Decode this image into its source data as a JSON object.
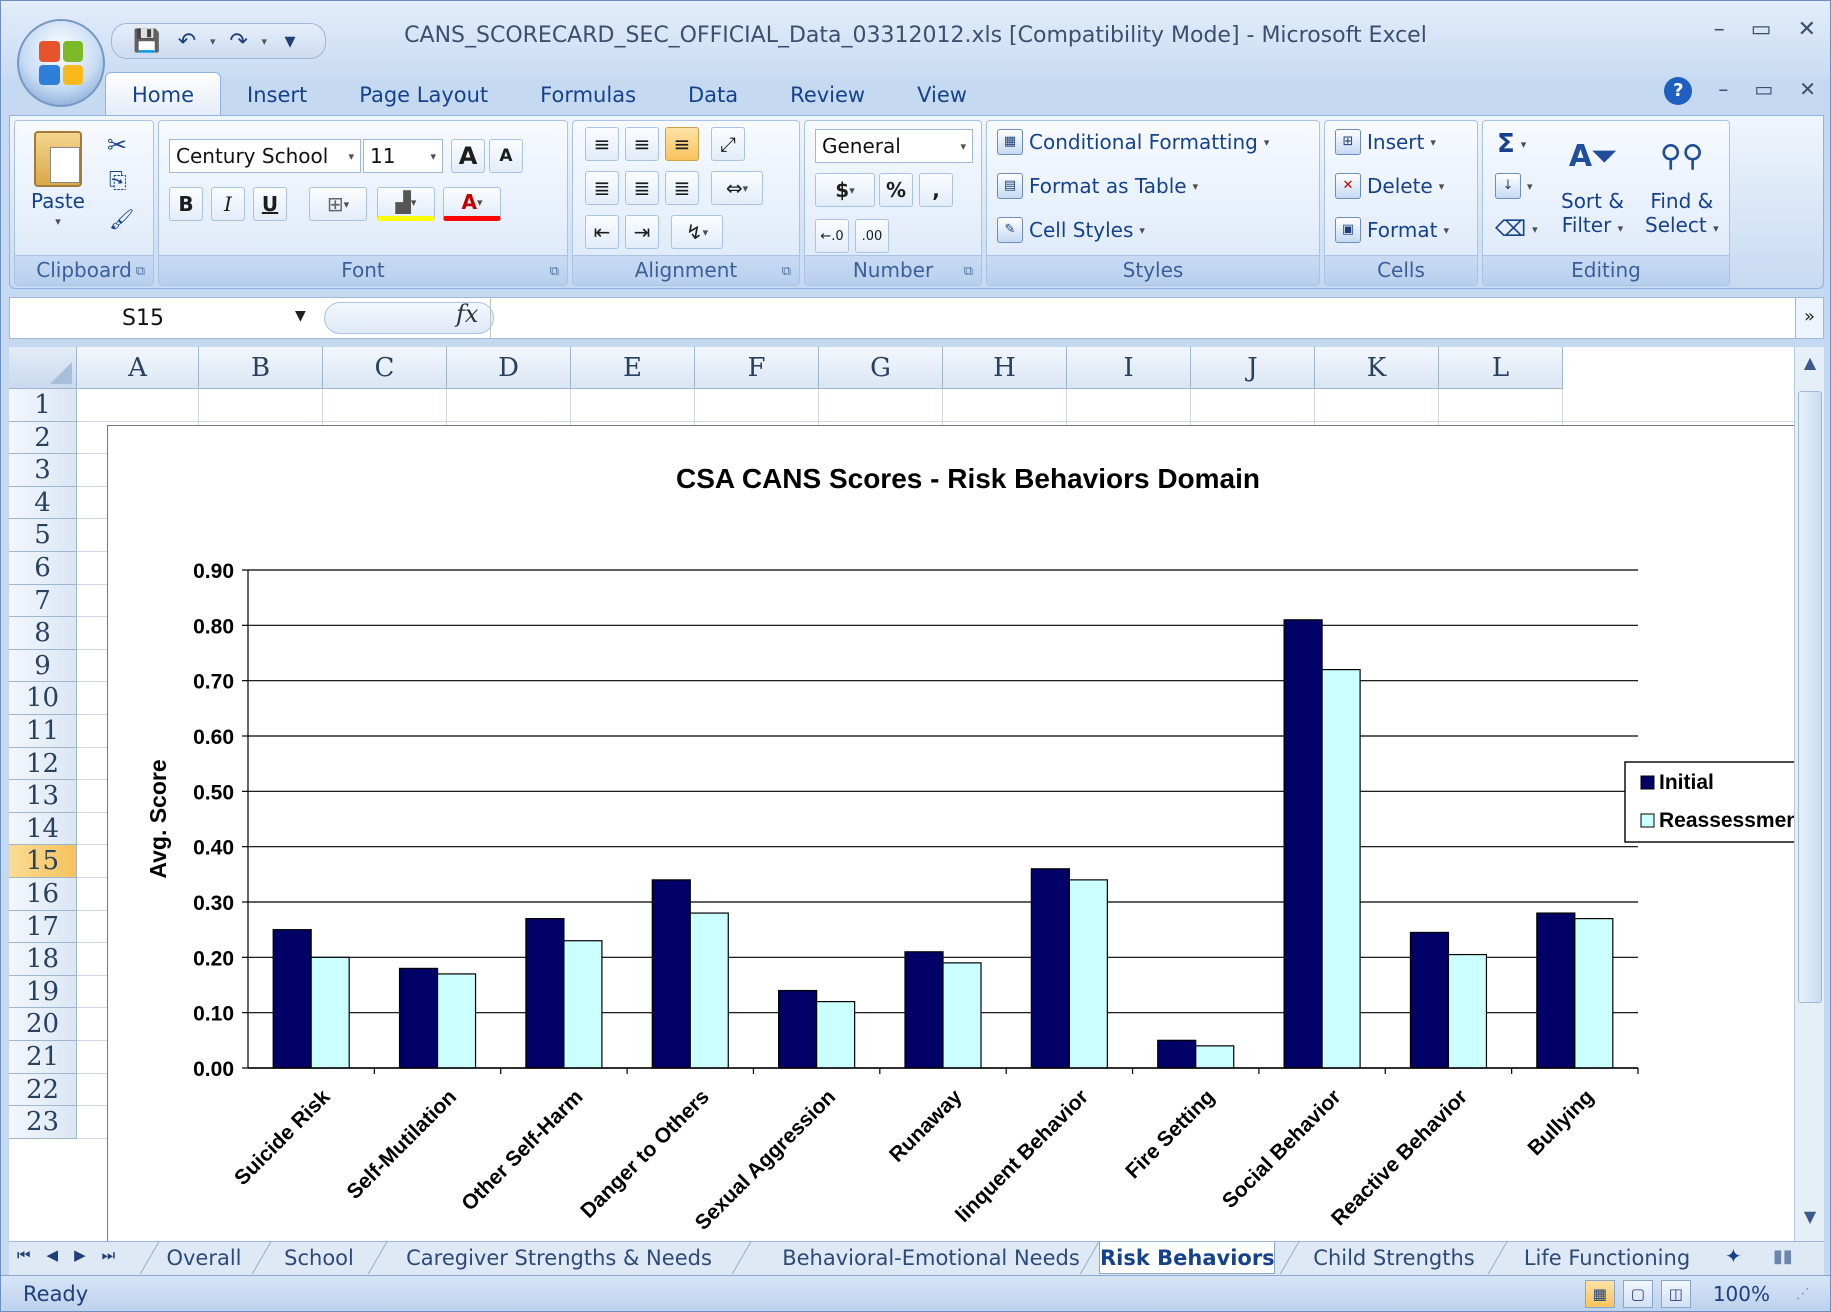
{
  "window": {
    "title": "CANS_SCORECARD_SEC_OFFICIAL_Data_03312012.xls  [Compatibility Mode] - Microsoft Excel",
    "minimize": "–",
    "restore": "▭",
    "close": "✕"
  },
  "qat": {
    "save": "💾",
    "undo": "↶",
    "redo": "↷",
    "customize": "▾"
  },
  "ribbon_tabs": [
    "Home",
    "Insert",
    "Page Layout",
    "Formulas",
    "Data",
    "Review",
    "View"
  ],
  "ribbon": {
    "clipboard": {
      "label": "Clipboard",
      "paste": "Paste",
      "cut": "✂",
      "copy": "⎘",
      "format_painter": "🖌"
    },
    "font": {
      "label": "Font",
      "name": "Century School",
      "size": "11",
      "grow": "A",
      "shrink": "A",
      "bold": "B",
      "italic": "I",
      "underline": "U",
      "borders": "⊞",
      "fill": "▟",
      "font_color": "A"
    },
    "alignment": {
      "label": "Alignment"
    },
    "number": {
      "label": "Number",
      "format": "General",
      "currency": "$",
      "percent": "%",
      "comma": ",",
      "inc_decimal": "←.0\n.00",
      "dec_decimal": ".00\n→.0"
    },
    "styles": {
      "label": "Styles",
      "conditional": "Conditional Formatting",
      "format_table": "Format as Table",
      "cell_styles": "Cell Styles"
    },
    "cells": {
      "label": "Cells",
      "insert": "Insert",
      "delete": "Delete",
      "format": "Format"
    },
    "editing": {
      "label": "Editing",
      "autosum": "Σ",
      "sort_filter_1": "Sort &",
      "sort_filter_2": "Filter",
      "find_select_1": "Find &",
      "find_select_2": "Select"
    }
  },
  "formula_bar": {
    "name_box": "S15",
    "fx": "fx",
    "content": ""
  },
  "columns": [
    "A",
    "B",
    "C",
    "D",
    "E",
    "F",
    "G",
    "H",
    "I",
    "J",
    "K",
    "L"
  ],
  "rows": [
    "1",
    "2",
    "3",
    "4",
    "5",
    "6",
    "7",
    "8",
    "9",
    "10",
    "11",
    "12",
    "13",
    "14",
    "15",
    "16",
    "17",
    "18",
    "19",
    "20",
    "21",
    "22",
    "23"
  ],
  "selected_row": "15",
  "sheet_tabs": [
    "Overall",
    "School",
    "Caregiver Strengths & Needs",
    "Behavioral-Emotional Needs",
    "Risk Behaviors",
    "Child Strengths",
    "Life Functioning"
  ],
  "active_sheet": "Risk Behaviors",
  "status": {
    "ready": "Ready",
    "zoom": "100%"
  },
  "colors": {
    "initial": "#000066",
    "reassessment": "#ccffff"
  },
  "chart_data": {
    "type": "bar",
    "title": "CSA CANS Scores - Risk Behaviors Domain",
    "xlabel": "",
    "ylabel": "Avg. Score",
    "ylim": [
      0,
      0.9
    ],
    "yticks": [
      "0.00",
      "0.10",
      "0.20",
      "0.30",
      "0.40",
      "0.50",
      "0.60",
      "0.70",
      "0.80",
      "0.90"
    ],
    "categories": [
      "Suicide Risk",
      "Self-Mutilation",
      "Other Self-Harm",
      "Danger to Others",
      "Sexual Aggression",
      "Runaway",
      "Delinquent Behavior",
      "Fire Setting",
      "Social Behavior",
      "Reactive Behavior",
      "Bullying"
    ],
    "categories_visible": [
      "Suicide Risk",
      "Self-Mutilation",
      "Other Self-Harm",
      "Danger to Others",
      "Sexual Aggression",
      "Runaway",
      "linquent Behavior",
      "Fire Setting",
      "Social Behavior",
      "Reactive Behavior",
      "Bullying"
    ],
    "series": [
      {
        "name": "Initial",
        "values": [
          0.25,
          0.18,
          0.27,
          0.34,
          0.14,
          0.21,
          0.36,
          0.05,
          0.81,
          0.245,
          0.28
        ]
      },
      {
        "name": "Reassessment",
        "values": [
          0.2,
          0.17,
          0.23,
          0.28,
          0.12,
          0.19,
          0.34,
          0.04,
          0.72,
          0.205,
          0.27
        ]
      }
    ],
    "legend_visible": [
      "Initial",
      "Reassessmen"
    ],
    "grid": true,
    "legend": "right"
  }
}
